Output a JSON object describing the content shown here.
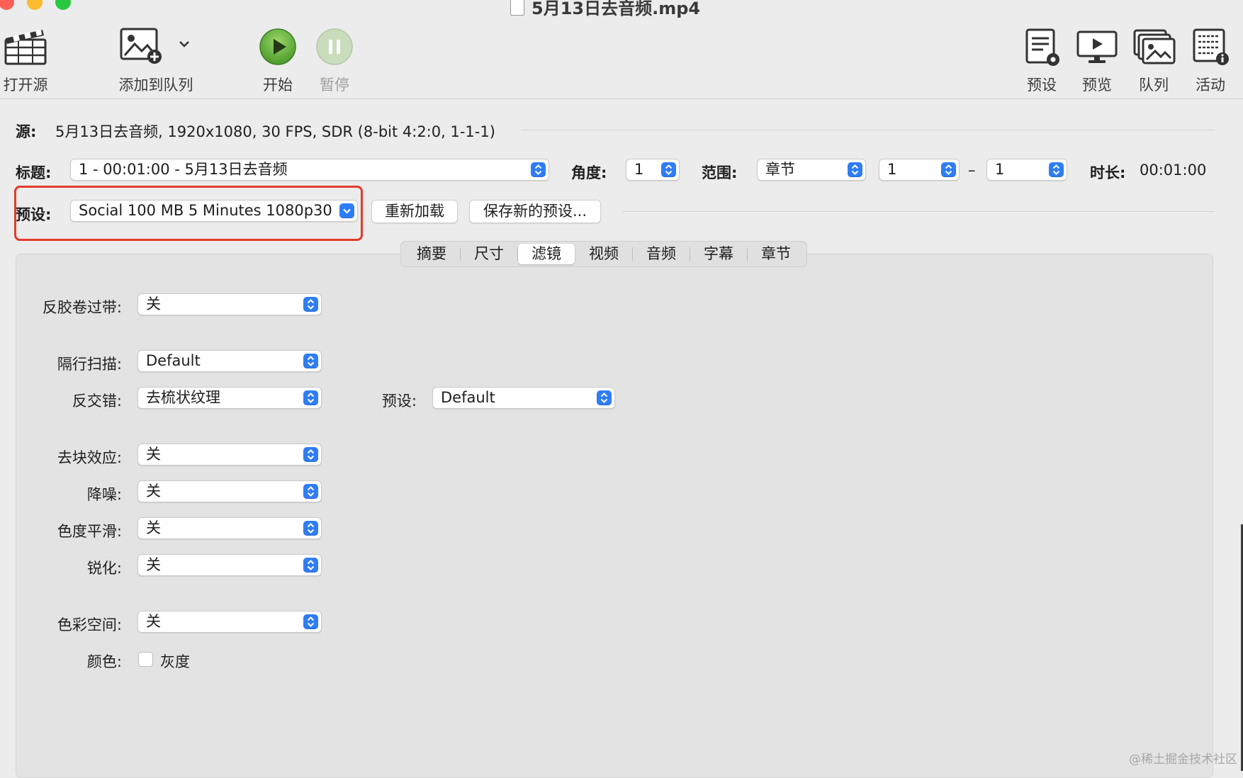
{
  "window": {
    "title": "5月13日去音频.mp4",
    "traffic_lights": {
      "close": "#ff5f57",
      "minimize": "#febc2e",
      "zoom": "#28c840"
    }
  },
  "toolbar": {
    "open_source": "打开源",
    "add_to_queue": "添加到队列",
    "start": "开始",
    "pause": "暂停",
    "presets": "预设",
    "preview": "预览",
    "queue": "队列",
    "activity": "活动"
  },
  "source": {
    "label": "源:",
    "value": "5月13日去音频, 1920x1080, 30 FPS, SDR (8-bit 4:2:0, 1-1-1)"
  },
  "title_row": {
    "title_label": "标题:",
    "title_value": "1 - 00:01:00 - 5月13日去音频",
    "angle_label": "角度:",
    "angle_value": "1",
    "range_label": "范围:",
    "range_type": "章节",
    "range_start": "1",
    "range_dash": "–",
    "range_end": "1",
    "duration_label": "时长:",
    "duration_value": "00:01:00"
  },
  "preset_row": {
    "label": "预设:",
    "value": "Social 100 MB 5 Minutes 1080p30",
    "reload_button": "重新加载",
    "save_button": "保存新的预设..."
  },
  "tabs": [
    {
      "label": "摘要",
      "active": false
    },
    {
      "label": "尺寸",
      "active": false
    },
    {
      "label": "滤镜",
      "active": true
    },
    {
      "label": "视频",
      "active": false
    },
    {
      "label": "音频",
      "active": false
    },
    {
      "label": "字幕",
      "active": false
    },
    {
      "label": "章节",
      "active": false
    }
  ],
  "filters": {
    "detelecine": {
      "label": "反胶卷过带:",
      "value": "关"
    },
    "interlace_detection": {
      "label": "隔行扫描:",
      "value": "Default"
    },
    "deinterlace": {
      "label": "反交错:",
      "value": "去梳状纹理"
    },
    "deinterlace_preset": {
      "label": "预设:",
      "value": "Default"
    },
    "deblock": {
      "label": "去块效应:",
      "value": "关"
    },
    "denoise": {
      "label": "降噪:",
      "value": "关"
    },
    "chroma_smooth": {
      "label": "色度平滑:",
      "value": "关"
    },
    "sharpen": {
      "label": "锐化:",
      "value": "关"
    },
    "colorspace": {
      "label": "色彩空间:",
      "value": "关"
    },
    "color": {
      "label": "颜色:",
      "grayscale_label": "灰度",
      "grayscale_checked": false
    }
  },
  "watermark": "@稀土掘金技术社区",
  "accent_color": "#2f7df6",
  "highlight_color": "#e43a2b"
}
